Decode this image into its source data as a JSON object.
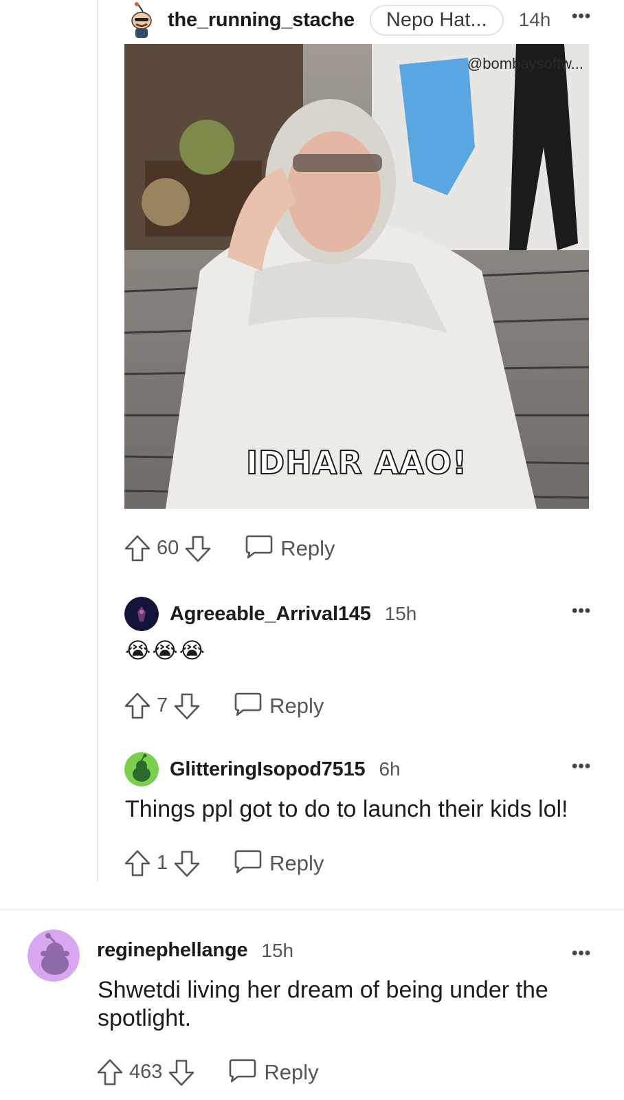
{
  "comments": [
    {
      "username": "the_running_stache",
      "flair": "Nepo Hat...",
      "time": "14h",
      "gif": {
        "caption": "IDHAR AAO!",
        "watermark": "@bombaysoftw..."
      },
      "votes": "60",
      "reply_label": "Reply"
    },
    {
      "username": "Agreeable_Arrival145",
      "time": "15h",
      "emojis": "😭😭😭",
      "votes": "7",
      "reply_label": "Reply"
    },
    {
      "username": "GlitteringIsopod7515",
      "time": "6h",
      "text": "Things ppl got to do to launch their kids lol!",
      "votes": "1",
      "reply_label": "Reply"
    },
    {
      "username": "reginephellange",
      "time": "15h",
      "text_lines": [
        "Shwetdi living her dream of being under the",
        "spotlight."
      ],
      "votes": "463",
      "reply_label": "Reply"
    }
  ],
  "more_glyph": "•••",
  "colors": {
    "snoo_green": "#7bcf4f",
    "snoo_purple": "#d9a6f0",
    "avatar_dark": "#14133a"
  },
  "icons": [
    "upvote-icon",
    "downvote-icon",
    "reply-bubble-icon",
    "more-icon",
    "snoo-avatar-icon"
  ]
}
